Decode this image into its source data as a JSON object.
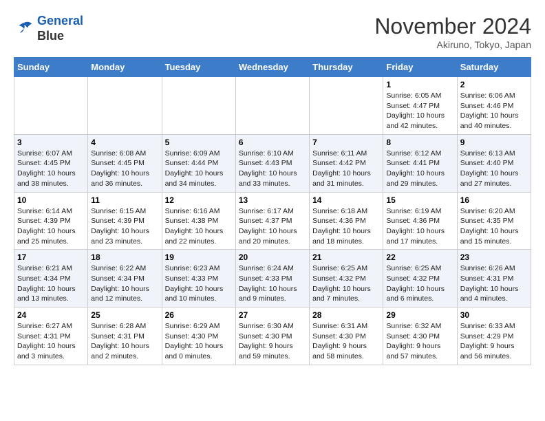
{
  "header": {
    "logo_line1": "General",
    "logo_line2": "Blue",
    "month": "November 2024",
    "location": "Akiruno, Tokyo, Japan"
  },
  "weekdays": [
    "Sunday",
    "Monday",
    "Tuesday",
    "Wednesday",
    "Thursday",
    "Friday",
    "Saturday"
  ],
  "weeks": [
    [
      {
        "day": "",
        "info": ""
      },
      {
        "day": "",
        "info": ""
      },
      {
        "day": "",
        "info": ""
      },
      {
        "day": "",
        "info": ""
      },
      {
        "day": "",
        "info": ""
      },
      {
        "day": "1",
        "info": "Sunrise: 6:05 AM\nSunset: 4:47 PM\nDaylight: 10 hours\nand 42 minutes."
      },
      {
        "day": "2",
        "info": "Sunrise: 6:06 AM\nSunset: 4:46 PM\nDaylight: 10 hours\nand 40 minutes."
      }
    ],
    [
      {
        "day": "3",
        "info": "Sunrise: 6:07 AM\nSunset: 4:45 PM\nDaylight: 10 hours\nand 38 minutes."
      },
      {
        "day": "4",
        "info": "Sunrise: 6:08 AM\nSunset: 4:45 PM\nDaylight: 10 hours\nand 36 minutes."
      },
      {
        "day": "5",
        "info": "Sunrise: 6:09 AM\nSunset: 4:44 PM\nDaylight: 10 hours\nand 34 minutes."
      },
      {
        "day": "6",
        "info": "Sunrise: 6:10 AM\nSunset: 4:43 PM\nDaylight: 10 hours\nand 33 minutes."
      },
      {
        "day": "7",
        "info": "Sunrise: 6:11 AM\nSunset: 4:42 PM\nDaylight: 10 hours\nand 31 minutes."
      },
      {
        "day": "8",
        "info": "Sunrise: 6:12 AM\nSunset: 4:41 PM\nDaylight: 10 hours\nand 29 minutes."
      },
      {
        "day": "9",
        "info": "Sunrise: 6:13 AM\nSunset: 4:40 PM\nDaylight: 10 hours\nand 27 minutes."
      }
    ],
    [
      {
        "day": "10",
        "info": "Sunrise: 6:14 AM\nSunset: 4:39 PM\nDaylight: 10 hours\nand 25 minutes."
      },
      {
        "day": "11",
        "info": "Sunrise: 6:15 AM\nSunset: 4:39 PM\nDaylight: 10 hours\nand 23 minutes."
      },
      {
        "day": "12",
        "info": "Sunrise: 6:16 AM\nSunset: 4:38 PM\nDaylight: 10 hours\nand 22 minutes."
      },
      {
        "day": "13",
        "info": "Sunrise: 6:17 AM\nSunset: 4:37 PM\nDaylight: 10 hours\nand 20 minutes."
      },
      {
        "day": "14",
        "info": "Sunrise: 6:18 AM\nSunset: 4:36 PM\nDaylight: 10 hours\nand 18 minutes."
      },
      {
        "day": "15",
        "info": "Sunrise: 6:19 AM\nSunset: 4:36 PM\nDaylight: 10 hours\nand 17 minutes."
      },
      {
        "day": "16",
        "info": "Sunrise: 6:20 AM\nSunset: 4:35 PM\nDaylight: 10 hours\nand 15 minutes."
      }
    ],
    [
      {
        "day": "17",
        "info": "Sunrise: 6:21 AM\nSunset: 4:34 PM\nDaylight: 10 hours\nand 13 minutes."
      },
      {
        "day": "18",
        "info": "Sunrise: 6:22 AM\nSunset: 4:34 PM\nDaylight: 10 hours\nand 12 minutes."
      },
      {
        "day": "19",
        "info": "Sunrise: 6:23 AM\nSunset: 4:33 PM\nDaylight: 10 hours\nand 10 minutes."
      },
      {
        "day": "20",
        "info": "Sunrise: 6:24 AM\nSunset: 4:33 PM\nDaylight: 10 hours\nand 9 minutes."
      },
      {
        "day": "21",
        "info": "Sunrise: 6:25 AM\nSunset: 4:32 PM\nDaylight: 10 hours\nand 7 minutes."
      },
      {
        "day": "22",
        "info": "Sunrise: 6:25 AM\nSunset: 4:32 PM\nDaylight: 10 hours\nand 6 minutes."
      },
      {
        "day": "23",
        "info": "Sunrise: 6:26 AM\nSunset: 4:31 PM\nDaylight: 10 hours\nand 4 minutes."
      }
    ],
    [
      {
        "day": "24",
        "info": "Sunrise: 6:27 AM\nSunset: 4:31 PM\nDaylight: 10 hours\nand 3 minutes."
      },
      {
        "day": "25",
        "info": "Sunrise: 6:28 AM\nSunset: 4:31 PM\nDaylight: 10 hours\nand 2 minutes."
      },
      {
        "day": "26",
        "info": "Sunrise: 6:29 AM\nSunset: 4:30 PM\nDaylight: 10 hours\nand 0 minutes."
      },
      {
        "day": "27",
        "info": "Sunrise: 6:30 AM\nSunset: 4:30 PM\nDaylight: 9 hours\nand 59 minutes."
      },
      {
        "day": "28",
        "info": "Sunrise: 6:31 AM\nSunset: 4:30 PM\nDaylight: 9 hours\nand 58 minutes."
      },
      {
        "day": "29",
        "info": "Sunrise: 6:32 AM\nSunset: 4:30 PM\nDaylight: 9 hours\nand 57 minutes."
      },
      {
        "day": "30",
        "info": "Sunrise: 6:33 AM\nSunset: 4:29 PM\nDaylight: 9 hours\nand 56 minutes."
      }
    ]
  ]
}
